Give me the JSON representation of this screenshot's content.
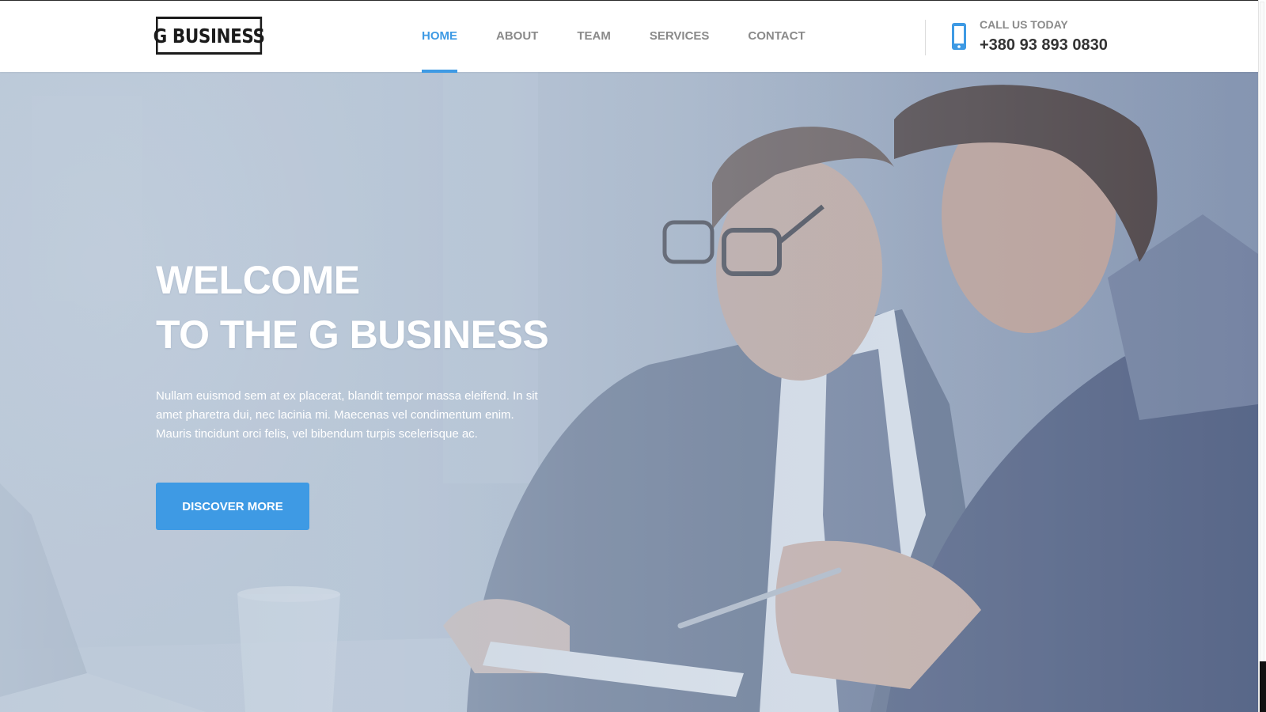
{
  "brand": {
    "logo_text": "G BUSINESS"
  },
  "nav": {
    "items": [
      {
        "label": "HOME",
        "active": true
      },
      {
        "label": "ABOUT"
      },
      {
        "label": "TEAM"
      },
      {
        "label": "SERVICES"
      },
      {
        "label": "CONTACT"
      }
    ]
  },
  "contact": {
    "icon": "mobile-phone-icon",
    "label": "CALL US TODAY",
    "number": "+380 93 893 0830"
  },
  "hero": {
    "title_line1": "WELCOME",
    "title_line2": "TO THE G BUSINESS",
    "text": "Nullam euismod sem at ex placerat, blandit tempor massa eleifend. In sit amet pharetra dui, nec lacinia mi. Maecenas vel condimentum enim. Mauris tincidunt orci felis, vel bibendum turpis scelerisque ac.",
    "button_label": "DISCOVER MORE",
    "image": "two-businessmen-photo"
  },
  "colors": {
    "accent": "#3e9ae4",
    "nav_text": "#8a8a8a",
    "logo": "#1b1b1b"
  }
}
